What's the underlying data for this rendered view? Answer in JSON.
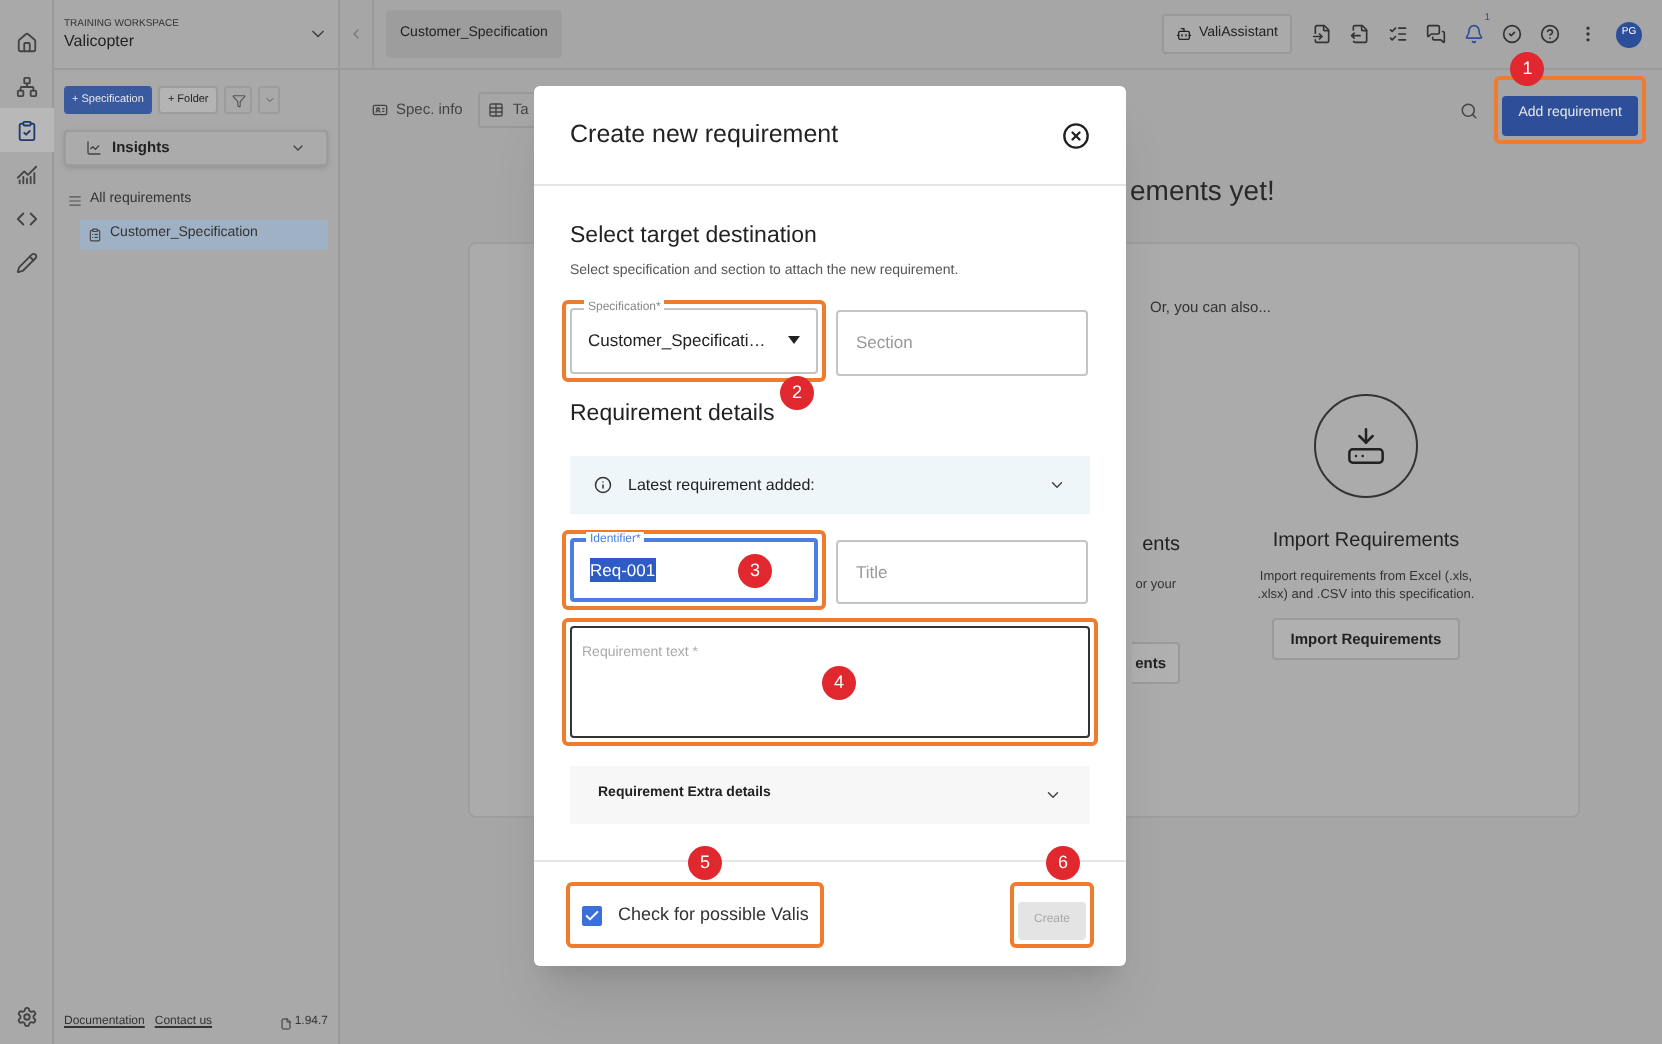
{
  "rail": {
    "items": [
      {
        "selected": false
      },
      {
        "selected": false
      },
      {
        "selected": true
      },
      {
        "selected": false
      },
      {
        "selected": false
      },
      {
        "selected": false
      }
    ]
  },
  "workspace": {
    "caption": "TRAINING WORKSPACE",
    "name": "Valicopter"
  },
  "sidebar": {
    "buttons": [
      "+ Specification",
      "+ Folder"
    ],
    "insights": "Insights",
    "tree": [
      {
        "label": "All requirements",
        "selected": false,
        "children": [
          {
            "label": "Customer_Specification",
            "selected": true
          }
        ]
      }
    ]
  },
  "footer": {
    "links": [
      "Documentation",
      "Contact us"
    ],
    "version": "1.94.7"
  },
  "header": {
    "tab": "Customer_Specification",
    "assistant": "ValiAssistant",
    "notification_count": "1",
    "avatar": "PG"
  },
  "subheader": {
    "tabs": [
      "Spec. info",
      "Ta"
    ],
    "add_button": {
      "label": "Add requirement",
      "annotation": "1"
    }
  },
  "background": {
    "heading": "ements yet!",
    "alternatives": "Or, you can also...",
    "cards": [
      {
        "title": "ents",
        "description": "or your",
        "button": "ents"
      },
      {
        "title": "Import Requirements",
        "description": "Import requirements from Excel (.xls, .xlsx) and .CSV into this specification.",
        "button": "Import Requirements"
      }
    ]
  },
  "dialog": {
    "title": "Create new requirement",
    "section_title": "Select target destination",
    "section_hint": "Select specification and section to attach the new requirement.",
    "specification": {
      "label": "Specification*",
      "value": "Customer_Specificati…",
      "annotation": "2"
    },
    "section": {
      "placeholder": "Section"
    },
    "details_title": "Requirement details",
    "latest": {
      "label": "Latest requirement added:",
      "expanded": false
    },
    "identifier": {
      "label": "Identifier*",
      "value": "Req-001",
      "focused": true,
      "annotation": "3"
    },
    "title_field": {
      "placeholder": "Title"
    },
    "text": {
      "placeholder": "Requirement text *",
      "annotation": "4"
    },
    "extra": {
      "label": "Requirement Extra details",
      "expanded": false
    },
    "check": {
      "label": "Check for possible Valis",
      "checked": true,
      "annotation": "5"
    },
    "create": {
      "label": "Create",
      "disabled": true,
      "annotation": "6"
    }
  }
}
